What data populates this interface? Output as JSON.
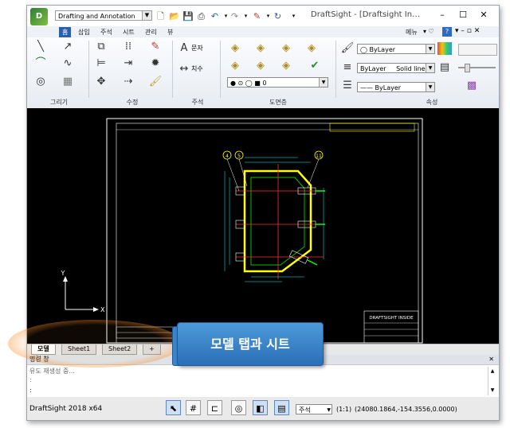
{
  "titlebar": {
    "workspace": "Drafting and Annotation",
    "title": "DraftSight - [Draftsight In…"
  },
  "ribbon_tabs": [
    "홈",
    "삽입",
    "주석",
    "시트",
    "관리",
    "뷰"
  ],
  "menu_label": "메뉴",
  "ribbon": {
    "groups": {
      "draw": "그리기",
      "modify": "수정",
      "annotate": "주석",
      "layer": "도면층",
      "properties": "속성"
    },
    "text_btn": "문자",
    "dim_btn": "치수",
    "layer_select": "0",
    "color_select": "ByLayer",
    "linestyle_select": "ByLayer",
    "linestyle_name": "Solid line",
    "lineweight_select": "ByLayer"
  },
  "sheet_tabs": [
    "모델",
    "Sheet1",
    "Sheet2",
    "+"
  ],
  "command_window": {
    "title": "명령 창",
    "line1": "유도 재생성 중...",
    "line2": ":",
    "line3": ":"
  },
  "statusbar": {
    "version": "DraftSight 2018 x64",
    "annotation_select": "주석",
    "scale": "(1:1)",
    "coordinates": "(24080.1864,-154.3556,0.0000)"
  },
  "drawing": {
    "axis_x": "X",
    "axis_y": "Y",
    "title_block": "DRAFTSIGHT INSIDE",
    "balloons": [
      "4",
      "5",
      "11"
    ]
  },
  "callout": "모델 탭과 시트",
  "colors": {
    "ribbon_active_tab": "#2c5fa8",
    "callout": "#3a86cc",
    "highlight": "#ff8c28"
  }
}
